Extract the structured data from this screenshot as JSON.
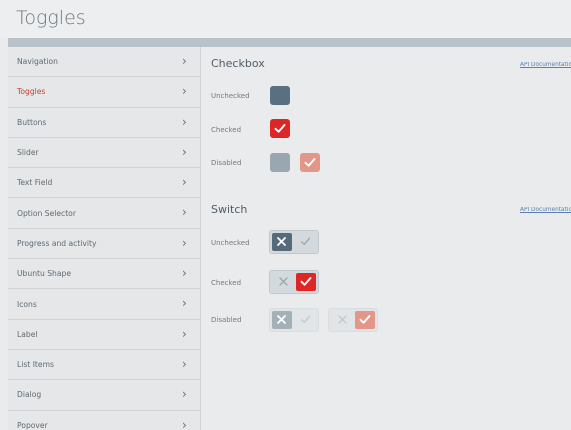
{
  "header": {
    "title": "Toggles"
  },
  "sidebar": {
    "items": [
      {
        "label": "Navigation",
        "active": false
      },
      {
        "label": "Toggles",
        "active": true
      },
      {
        "label": "Buttons",
        "active": false
      },
      {
        "label": "Slider",
        "active": false
      },
      {
        "label": "Text Field",
        "active": false
      },
      {
        "label": "Option Selector",
        "active": false
      },
      {
        "label": "Progress and activity",
        "active": false
      },
      {
        "label": "Ubuntu Shape",
        "active": false
      },
      {
        "label": "Icons",
        "active": false
      },
      {
        "label": "Label",
        "active": false
      },
      {
        "label": "List Items",
        "active": false
      },
      {
        "label": "Dialog",
        "active": false
      },
      {
        "label": "Popover",
        "active": false
      }
    ],
    "chevron": "›"
  },
  "checkbox_section": {
    "title": "Checkbox",
    "api_link": "API Documentation",
    "rows": [
      {
        "label": "Unchecked",
        "state": "unchecked"
      },
      {
        "label": "Checked",
        "state": "checked"
      },
      {
        "label": "Disabled",
        "state": "disabled"
      }
    ]
  },
  "switch_section": {
    "title": "Switch",
    "api_link": "API Documentation",
    "rows": [
      {
        "label": "Unchecked",
        "state": "unchecked"
      },
      {
        "label": "Checked",
        "state": "checked"
      },
      {
        "label": "Disabled",
        "state": "disabled"
      }
    ]
  },
  "icons": {
    "checkmark": "checkmark-icon",
    "cross": "cross-icon",
    "chevron": "chevron-right-icon"
  },
  "colors": {
    "accent": "#dd2727",
    "unchecked": "#5a7080",
    "disabled_unchecked": "#9aa7b0",
    "disabled_checked": "#e49688",
    "link": "#5a7fb0"
  }
}
